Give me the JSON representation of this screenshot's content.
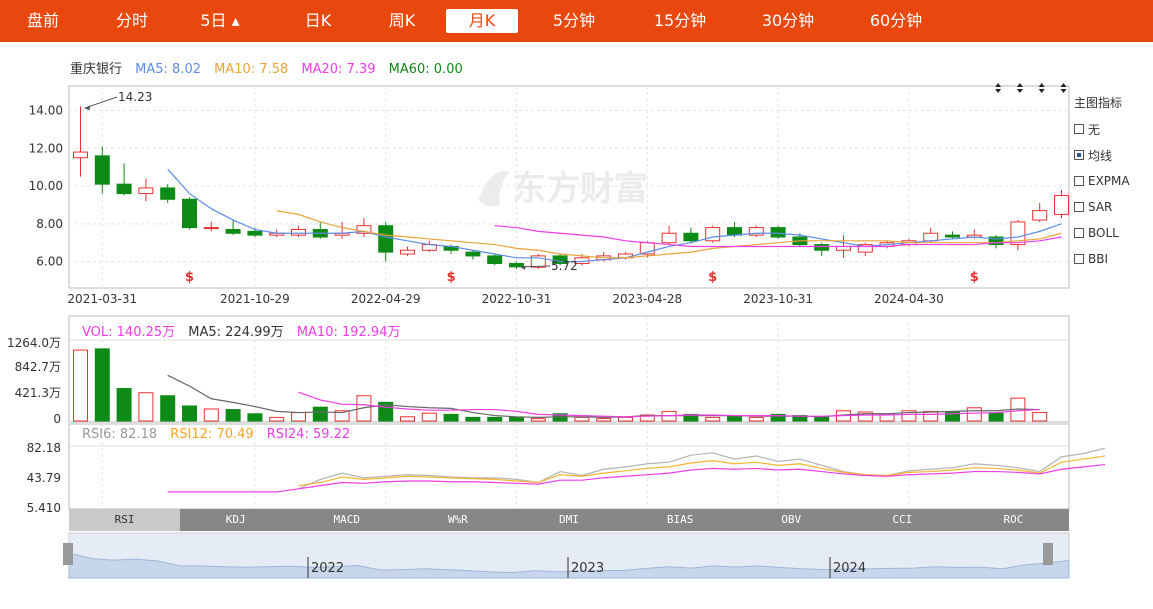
{
  "tabs": [
    {
      "label": "盘前",
      "active": false
    },
    {
      "label": "分时",
      "active": false
    },
    {
      "label": "5日 ▴",
      "active": false
    },
    {
      "label": "日K",
      "active": false
    },
    {
      "label": "周K",
      "active": false
    },
    {
      "label": "月K",
      "active": true
    },
    {
      "label": "5分钟",
      "active": false
    },
    {
      "label": "15分钟",
      "active": false
    },
    {
      "label": "30分钟",
      "active": false
    },
    {
      "label": "60分钟",
      "active": false
    }
  ],
  "legend": {
    "name": "重庆银行",
    "ma5": "MA5: 8.02",
    "ma10": "MA10: 7.58",
    "ma20": "MA20: 7.39",
    "ma60": "MA60: 0.00"
  },
  "watermark": "东方财富",
  "indicator_panel": {
    "title": "主图指标",
    "options": [
      {
        "label": "无",
        "checked": false
      },
      {
        "label": "均线",
        "checked": true
      },
      {
        "label": "EXPMA",
        "checked": false
      },
      {
        "label": "SAR",
        "checked": false
      },
      {
        "label": "BOLL",
        "checked": false
      },
      {
        "label": "BBI",
        "checked": false
      }
    ]
  },
  "vol_legend": {
    "vol": "VOL: 140.25万",
    "ma5": "MA5: 224.99万",
    "ma10": "MA10: 192.94万"
  },
  "rsi_legend": {
    "rsi6": "RSI6: 82.18",
    "rsi12": "RSI12: 70.49",
    "rsi24": "RSI24: 59.22"
  },
  "indicator_tabs": [
    "RSI",
    "KDJ",
    "MACD",
    "W%R",
    "DMI",
    "BIAS",
    "OBV",
    "CCI",
    "ROC"
  ],
  "navigator_years": [
    "2022",
    "2023",
    "2024"
  ],
  "colors": {
    "up": "#e8312f",
    "down": "#0e8a16",
    "ma5": "#5b8de6",
    "ma10": "#e8a43a",
    "ma20": "#ee3ce7",
    "ma60": "#0e8a16",
    "accent": "#e8480e",
    "rsi6": "#b3b3b3",
    "rsi12": "#f5b52e",
    "rsi24": "#ee3ce7"
  },
  "chart_data": {
    "type": "candlestick",
    "y_ticks": [
      "14.00",
      "12.00",
      "10.00",
      "8.00",
      "6.00"
    ],
    "ylim": [
      4.6,
      15.3
    ],
    "x_labels": [
      {
        "label": "2021-03-31",
        "index": 1
      },
      {
        "label": "2021-10-29",
        "index": 8
      },
      {
        "label": "2022-04-29",
        "index": 14
      },
      {
        "label": "2022-10-31",
        "index": 20
      },
      {
        "label": "2023-04-28",
        "index": 26
      },
      {
        "label": "2023-10-31",
        "index": 32
      },
      {
        "label": "2024-04-30",
        "index": 38
      }
    ],
    "annotations": [
      {
        "text": "14.23",
        "index": 0,
        "value": 14.23
      },
      {
        "text": "5.72",
        "index": 20,
        "value": 5.72
      }
    ],
    "dividend_marks": [
      5,
      17,
      29,
      41
    ],
    "top_marks": [
      42,
      43,
      44,
      45
    ],
    "candles": [
      {
        "o": 11.5,
        "c": 11.8,
        "h": 14.23,
        "l": 10.5
      },
      {
        "o": 11.6,
        "c": 10.1,
        "h": 12.1,
        "l": 9.6
      },
      {
        "o": 10.1,
        "c": 9.6,
        "h": 11.2,
        "l": 9.5
      },
      {
        "o": 9.6,
        "c": 9.9,
        "h": 10.4,
        "l": 9.2
      },
      {
        "o": 9.9,
        "c": 9.3,
        "h": 10.1,
        "l": 9.1
      },
      {
        "o": 9.3,
        "c": 7.8,
        "h": 9.4,
        "l": 7.7
      },
      {
        "o": 7.8,
        "c": 7.8,
        "h": 8.1,
        "l": 7.6
      },
      {
        "o": 7.7,
        "c": 7.5,
        "h": 8.2,
        "l": 7.4
      },
      {
        "o": 7.6,
        "c": 7.4,
        "h": 7.8,
        "l": 7.3
      },
      {
        "o": 7.4,
        "c": 7.5,
        "h": 7.7,
        "l": 7.3
      },
      {
        "o": 7.4,
        "c": 7.7,
        "h": 7.9,
        "l": 7.3
      },
      {
        "o": 7.7,
        "c": 7.3,
        "h": 8.1,
        "l": 7.2
      },
      {
        "o": 7.4,
        "c": 7.5,
        "h": 8.1,
        "l": 7.2
      },
      {
        "o": 7.5,
        "c": 7.9,
        "h": 8.3,
        "l": 7.3
      },
      {
        "o": 7.9,
        "c": 6.5,
        "h": 8.1,
        "l": 6.0
      },
      {
        "o": 6.4,
        "c": 6.6,
        "h": 6.8,
        "l": 6.3
      },
      {
        "o": 6.6,
        "c": 6.9,
        "h": 7.1,
        "l": 6.5
      },
      {
        "o": 6.8,
        "c": 6.6,
        "h": 6.9,
        "l": 6.4
      },
      {
        "o": 6.5,
        "c": 6.3,
        "h": 6.6,
        "l": 6.1
      },
      {
        "o": 6.3,
        "c": 5.9,
        "h": 6.4,
        "l": 5.8
      },
      {
        "o": 5.9,
        "c": 5.72,
        "h": 6.0,
        "l": 5.6
      },
      {
        "o": 5.7,
        "c": 6.3,
        "h": 6.4,
        "l": 5.6
      },
      {
        "o": 6.3,
        "c": 5.9,
        "h": 6.4,
        "l": 5.8
      },
      {
        "o": 5.9,
        "c": 6.2,
        "h": 6.4,
        "l": 5.8
      },
      {
        "o": 6.1,
        "c": 6.3,
        "h": 6.5,
        "l": 6.0
      },
      {
        "o": 6.2,
        "c": 6.4,
        "h": 6.5,
        "l": 6.1
      },
      {
        "o": 6.4,
        "c": 7.0,
        "h": 7.1,
        "l": 6.2
      },
      {
        "o": 7.0,
        "c": 7.5,
        "h": 7.9,
        "l": 6.9
      },
      {
        "o": 7.5,
        "c": 7.1,
        "h": 7.8,
        "l": 7.0
      },
      {
        "o": 7.1,
        "c": 7.8,
        "h": 7.9,
        "l": 7.0
      },
      {
        "o": 7.8,
        "c": 7.4,
        "h": 8.1,
        "l": 7.3
      },
      {
        "o": 7.4,
        "c": 7.8,
        "h": 7.9,
        "l": 7.3
      },
      {
        "o": 7.8,
        "c": 7.3,
        "h": 7.9,
        "l": 7.2
      },
      {
        "o": 7.3,
        "c": 6.9,
        "h": 7.5,
        "l": 6.8
      },
      {
        "o": 6.9,
        "c": 6.6,
        "h": 7.0,
        "l": 6.3
      },
      {
        "o": 6.6,
        "c": 6.8,
        "h": 7.4,
        "l": 6.2
      },
      {
        "o": 6.5,
        "c": 6.9,
        "h": 7.0,
        "l": 6.3
      },
      {
        "o": 6.8,
        "c": 7.0,
        "h": 7.1,
        "l": 6.7
      },
      {
        "o": 6.9,
        "c": 7.1,
        "h": 7.2,
        "l": 6.8
      },
      {
        "o": 7.1,
        "c": 7.5,
        "h": 7.8,
        "l": 7.0
      },
      {
        "o": 7.4,
        "c": 7.3,
        "h": 7.6,
        "l": 7.2
      },
      {
        "o": 7.3,
        "c": 7.4,
        "h": 7.7,
        "l": 7.2
      },
      {
        "o": 7.3,
        "c": 6.9,
        "h": 7.4,
        "l": 6.7
      },
      {
        "o": 6.9,
        "c": 8.1,
        "h": 8.2,
        "l": 6.6
      },
      {
        "o": 8.2,
        "c": 8.7,
        "h": 9.1,
        "l": 8.1
      },
      {
        "o": 8.5,
        "c": 9.5,
        "h": 9.8,
        "l": 8.3
      }
    ],
    "ma5": [
      null,
      null,
      null,
      null,
      10.9,
      9.6,
      8.8,
      8.2,
      7.7,
      7.5,
      7.5,
      7.5,
      7.5,
      7.6,
      7.3,
      7.1,
      6.9,
      6.8,
      6.6,
      6.4,
      6.2,
      6.2,
      6.0,
      6.0,
      6.1,
      6.2,
      6.5,
      6.8,
      7.0,
      7.3,
      7.4,
      7.5,
      7.5,
      7.4,
      7.2,
      7.0,
      6.8,
      6.9,
      7.0,
      7.1,
      7.2,
      7.3,
      7.2,
      7.3,
      7.6,
      8.0
    ],
    "ma10": [
      null,
      null,
      null,
      null,
      null,
      null,
      null,
      null,
      null,
      8.7,
      8.5,
      8.1,
      7.8,
      7.6,
      7.4,
      7.3,
      7.2,
      7.1,
      7.0,
      6.9,
      6.7,
      6.6,
      6.4,
      6.3,
      6.2,
      6.2,
      6.3,
      6.4,
      6.5,
      6.7,
      6.8,
      6.9,
      7.0,
      7.1,
      7.1,
      7.1,
      7.1,
      7.1,
      7.0,
      7.0,
      7.0,
      7.0,
      7.0,
      7.1,
      7.2,
      7.5
    ],
    "ma20": [
      null,
      null,
      null,
      null,
      null,
      null,
      null,
      null,
      null,
      null,
      null,
      null,
      null,
      null,
      null,
      null,
      null,
      null,
      null,
      7.9,
      7.8,
      7.6,
      7.5,
      7.4,
      7.3,
      7.1,
      7.0,
      6.9,
      6.8,
      6.8,
      6.8,
      6.8,
      6.8,
      6.8,
      6.8,
      6.8,
      6.8,
      6.8,
      6.9,
      6.9,
      6.9,
      6.9,
      7.0,
      7.0,
      7.1,
      7.3
    ],
    "volume": {
      "y_ticks": [
        "1264.0万",
        "842.7万",
        "421.3万",
        "0"
      ],
      "ylim": [
        0,
        1264
      ],
      "values": [
        1180,
        1200,
        540,
        470,
        420,
        250,
        200,
        190,
        120,
        60,
        140,
        230,
        170,
        420,
        310,
        70,
        130,
        110,
        60,
        60,
        60,
        40,
        120,
        60,
        40,
        60,
        100,
        160,
        110,
        60,
        80,
        60,
        110,
        90,
        70,
        170,
        150,
        120,
        170,
        160,
        150,
        220,
        130,
        380,
        140
      ],
      "ma5": [
        null,
        null,
        null,
        null,
        760,
        580,
        370,
        310,
        240,
        160,
        140,
        150,
        140,
        220,
        270,
        240,
        220,
        210,
        140,
        90,
        70,
        60,
        70,
        70,
        60,
        70,
        90,
        90,
        90,
        90,
        90,
        80,
        80,
        80,
        70,
        100,
        120,
        120,
        140,
        150,
        160,
        170,
        170,
        200,
        190
      ],
      "ma10": [
        null,
        null,
        null,
        null,
        null,
        null,
        null,
        null,
        null,
        null,
        480,
        350,
        280,
        270,
        230,
        200,
        180,
        180,
        190,
        190,
        160,
        110,
        100,
        90,
        80,
        70,
        80,
        90,
        100,
        100,
        90,
        90,
        90,
        80,
        80,
        90,
        100,
        100,
        110,
        110,
        120,
        130,
        140,
        170,
        190
      ]
    },
    "rsi": {
      "y_ticks": [
        "82.18",
        "43.79",
        "5.410"
      ],
      "ylim": [
        5.41,
        82.18
      ],
      "rsi6": [
        null,
        null,
        null,
        null,
        null,
        null,
        null,
        null,
        null,
        null,
        30,
        42,
        50,
        44,
        46,
        48,
        47,
        45,
        44,
        44,
        42,
        38,
        52,
        47,
        55,
        58,
        62,
        64,
        73,
        76,
        68,
        72,
        65,
        68,
        60,
        52,
        48,
        47,
        53,
        55,
        57,
        62,
        60,
        57,
        52,
        71,
        75,
        82
      ],
      "rsi12": [
        null,
        null,
        null,
        null,
        null,
        null,
        null,
        null,
        null,
        null,
        34,
        38,
        45,
        42,
        44,
        46,
        45,
        44,
        43,
        42,
        40,
        38,
        48,
        46,
        50,
        53,
        56,
        58,
        63,
        66,
        62,
        64,
        60,
        62,
        56,
        51,
        48,
        47,
        51,
        52,
        54,
        57,
        56,
        54,
        50,
        64,
        68,
        72
      ],
      "rsi24": [
        null,
        null,
        null,
        null,
        26,
        26,
        26,
        26,
        26,
        26,
        30,
        34,
        38,
        37,
        39,
        40,
        40,
        39,
        39,
        38,
        37,
        36,
        41,
        41,
        44,
        46,
        48,
        50,
        54,
        56,
        55,
        56,
        54,
        55,
        52,
        49,
        47,
        46,
        48,
        49,
        50,
        52,
        52,
        51,
        49,
        55,
        58,
        61
      ]
    }
  }
}
